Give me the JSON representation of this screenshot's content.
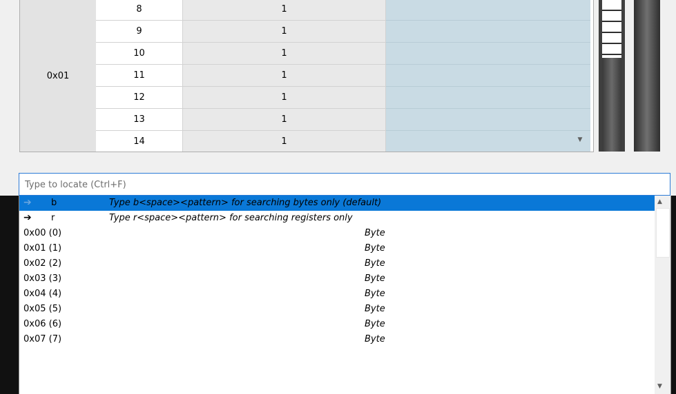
{
  "table": {
    "group_label": "0x01",
    "rows": [
      {
        "index": "8",
        "value": "1"
      },
      {
        "index": "9",
        "value": "1"
      },
      {
        "index": "10",
        "value": "1"
      },
      {
        "index": "11",
        "value": "1"
      },
      {
        "index": "12",
        "value": "1"
      },
      {
        "index": "13",
        "value": "1"
      },
      {
        "index": "14",
        "value": "1"
      }
    ],
    "scroll_down_icon": "chevron-down-icon"
  },
  "search": {
    "placeholder": "Type to locate (Ctrl+F)",
    "value": ""
  },
  "dropdown": {
    "hints": [
      {
        "icon": "arrow-right-icon",
        "key": "b",
        "text": "Type b<space><pattern> for searching bytes only (default)",
        "selected": true
      },
      {
        "icon": "arrow-right-icon",
        "key": "r",
        "text": "Type r<space><pattern> for searching registers only",
        "selected": false
      }
    ],
    "items": [
      {
        "label": "0x00 (0)",
        "type": "Byte"
      },
      {
        "label": "0x01 (1)",
        "type": "Byte"
      },
      {
        "label": "0x02 (2)",
        "type": "Byte"
      },
      {
        "label": "0x03 (3)",
        "type": "Byte"
      },
      {
        "label": "0x04 (4)",
        "type": "Byte"
      },
      {
        "label": "0x05 (5)",
        "type": "Byte"
      },
      {
        "label": "0x06 (6)",
        "type": "Byte"
      },
      {
        "label": "0x07 (7)",
        "type": "Byte"
      }
    ]
  },
  "colors": {
    "selection": "#0a78d7",
    "focus_border": "#2b7ad6",
    "table_highlight": "#c9dbe4"
  }
}
